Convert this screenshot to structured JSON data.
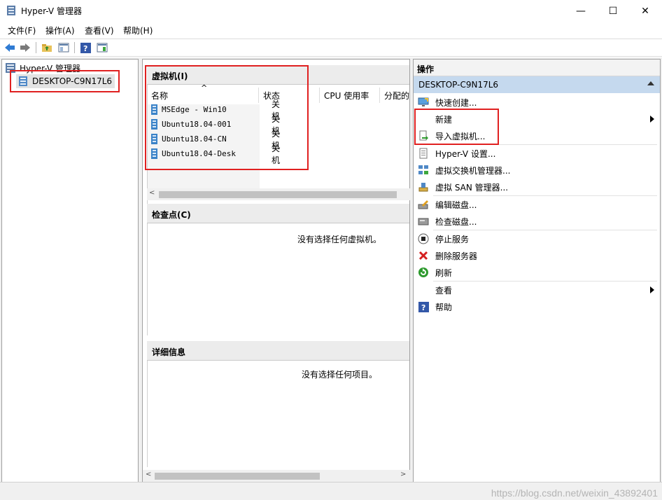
{
  "window": {
    "title": "Hyper-V 管理器",
    "minimize": "—",
    "maximize": "☐",
    "close": "✕"
  },
  "menu": [
    "文件(F)",
    "操作(A)",
    "查看(V)",
    "帮助(H)"
  ],
  "tree": {
    "root": "Hyper-V 管理器",
    "host": "DESKTOP-C9N17L6"
  },
  "vms": {
    "title": "虚拟机(I)",
    "columns": [
      "名称",
      "状态",
      "CPU 使用率",
      "分配的"
    ],
    "rows": [
      {
        "name": "MSEdge - Win10",
        "state": "关机"
      },
      {
        "name": "Ubuntu18.04-001",
        "state": "关机"
      },
      {
        "name": "Ubuntu18.04-CN",
        "state": "关机"
      },
      {
        "name": "Ubuntu18.04-Desk",
        "state": "关机"
      }
    ]
  },
  "checkpoints": {
    "title": "检查点(C)",
    "empty": "没有选择任何虚拟机。"
  },
  "details": {
    "title": "详细信息",
    "empty": "没有选择任何项目。"
  },
  "actions": {
    "title": "操作",
    "host": "DESKTOP-C9N17L6",
    "items": [
      {
        "label": "快速创建...",
        "icon": "quick-create-icon"
      },
      {
        "label": "新建",
        "icon": "new-icon"
      },
      {
        "label": "导入虚拟机...",
        "icon": "import-icon"
      },
      {
        "label": "Hyper-V 设置...",
        "icon": "settings-icon"
      },
      {
        "label": "虚拟交换机管理器...",
        "icon": "switch-icon"
      },
      {
        "label": "虚拟 SAN 管理器...",
        "icon": "san-icon"
      },
      {
        "label": "编辑磁盘...",
        "icon": "edit-disk-icon"
      },
      {
        "label": "检查磁盘...",
        "icon": "inspect-disk-icon"
      },
      {
        "label": "停止服务",
        "icon": "stop-icon"
      },
      {
        "label": "删除服务器",
        "icon": "delete-icon"
      },
      {
        "label": "刷新",
        "icon": "refresh-icon"
      },
      {
        "label": "查看",
        "icon": "view-icon"
      },
      {
        "label": "帮助",
        "icon": "help-icon"
      }
    ]
  },
  "watermark": "https://blog.csdn.net/weixin_43892401",
  "colors": {
    "highlight": "#c5d9ee",
    "annotation": "#e02020"
  }
}
